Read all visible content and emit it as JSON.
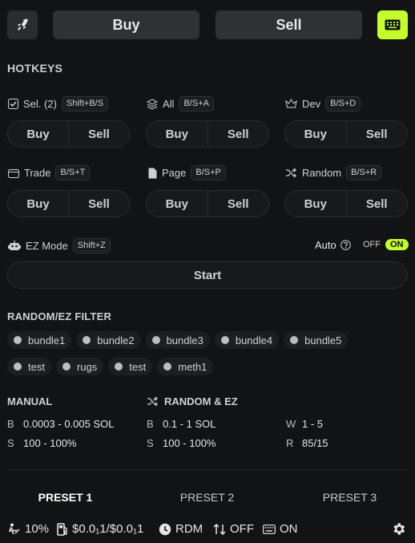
{
  "top": {
    "buy": "Buy",
    "sell": "Sell"
  },
  "hotkeys": {
    "title": "HOTKEYS",
    "groups": [
      {
        "label": "Sel. (2)",
        "shortcut": "Shift+B/S",
        "buy": "Buy",
        "sell": "Sell"
      },
      {
        "label": "All",
        "shortcut": "B/S+A",
        "buy": "Buy",
        "sell": "Sell"
      },
      {
        "label": "Dev",
        "shortcut": "B/S+D",
        "buy": "Buy",
        "sell": "Sell"
      },
      {
        "label": "Trade",
        "shortcut": "B/S+T",
        "buy": "Buy",
        "sell": "Sell"
      },
      {
        "label": "Page",
        "shortcut": "B/S+P",
        "buy": "Buy",
        "sell": "Sell"
      },
      {
        "label": "Random",
        "shortcut": "B/S+R",
        "buy": "Buy",
        "sell": "Sell"
      }
    ],
    "ez": {
      "label": "EZ Mode",
      "shortcut": "Shift+Z",
      "auto": "Auto",
      "off": "OFF",
      "on": "ON",
      "start": "Start"
    }
  },
  "filter": {
    "title": "RANDOM/EZ FILTER",
    "tags": [
      "bundle1",
      "bundle2",
      "bundle3",
      "bundle4",
      "bundle5",
      "test",
      "rugs",
      "test",
      "meth1"
    ]
  },
  "manual": {
    "title": "MANUAL",
    "b_key": "B",
    "b_val": "0.0003 - 0.005 SOL",
    "s_key": "S",
    "s_val": "100 - 100%"
  },
  "random_ez": {
    "title": "RANDOM & EZ",
    "b_key": "B",
    "b_val": "0.1 - 1 SOL",
    "s_key": "S",
    "s_val": "100 - 100%",
    "w_key": "W",
    "w_val": "1 - 5",
    "r_key": "R",
    "r_val": "85/15"
  },
  "presets": [
    "PRESET 1",
    "PRESET 2",
    "PRESET 3"
  ],
  "status": {
    "slippage": "10%",
    "fees": "$0.0₁1/$0.0₁1",
    "mode": "RDM",
    "sort": "OFF",
    "keyboard": "ON"
  },
  "colors": {
    "accent": "#c4ff2c",
    "background": "#121314"
  }
}
